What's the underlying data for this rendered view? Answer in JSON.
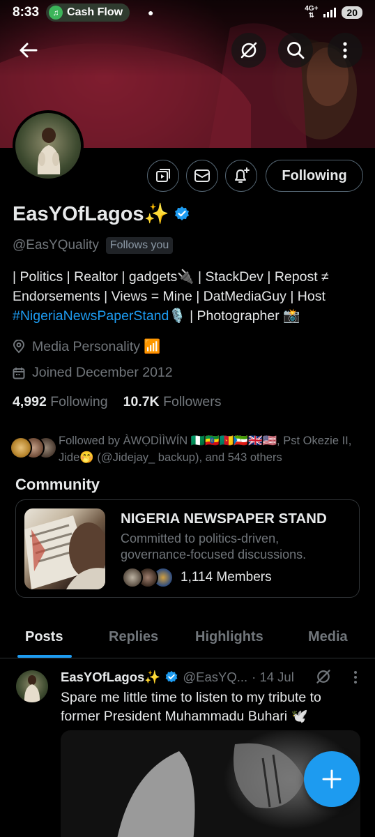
{
  "status_bar": {
    "time": "8:33",
    "app_pill": "Cash Flow",
    "network": "4G+",
    "battery": "20"
  },
  "profile": {
    "name": "EasYOfLagos✨",
    "handle": "@EasYQuality",
    "follows_you": "Follows you",
    "following_button": "Following",
    "bio_line1": "| Politics | Realtor | gadgets🔌 | StackDev | Repost ≠",
    "bio_line2": "Endorsements | Views = Mine | DatMediaGuy | Host",
    "bio_hashtag": "#NigeriaNewsPaperStand",
    "bio_line3_rest": "🎙️ | Photographer 📸",
    "category": "Media Personality 📶",
    "joined": "Joined December 2012",
    "following_count": "4,992",
    "following_label": "Following",
    "followers_count": "10.7K",
    "followers_label": "Followers",
    "followed_by": "Followed by ÀWỌDÌÌWÍN 🇳🇬🇪🇹🇨🇲🇬🇶🇬🇧🇺🇸, Pst Okezie II, Jide🤭 (@Jidejay_ backup), and 543 others"
  },
  "community": {
    "title": "Community",
    "name": "NIGERIA NEWSPAPER STAND",
    "description": "Committed to politics-driven, governance-focused discussions.",
    "members": "1,114 Members"
  },
  "tabs": [
    {
      "label": "Posts",
      "active": true
    },
    {
      "label": "Replies",
      "active": false
    },
    {
      "label": "Highlights",
      "active": false
    },
    {
      "label": "Media",
      "active": false
    }
  ],
  "post": {
    "author": "EasYOfLagos✨",
    "handle": "@EasYQ...",
    "date": "· 14 Jul",
    "text": "Spare me little time to listen to my tribute to former President Muhammadu Buhari 🕊️"
  },
  "colors": {
    "accent": "#1d9bf0",
    "muted": "#71767b",
    "text": "#e7e9ea",
    "background": "#000000"
  },
  "icons": [
    "back-arrow-icon",
    "grok-icon",
    "search-icon",
    "more-vertical-icon",
    "media-icon",
    "mail-icon",
    "bell-plus-icon",
    "verified-icon",
    "location-icon",
    "calendar-icon",
    "compose-plus-icon"
  ]
}
